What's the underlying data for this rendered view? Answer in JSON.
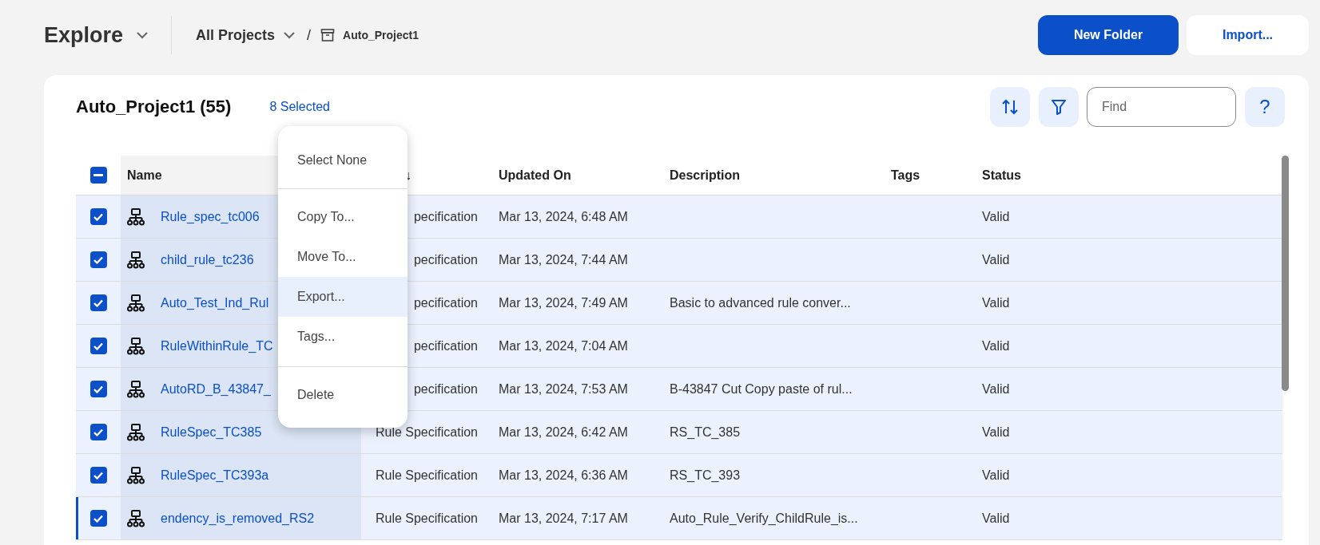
{
  "header": {
    "title": "Explore",
    "breadcrumb": {
      "root": "All Projects",
      "separator": "/",
      "current": "Auto_Project1"
    },
    "buttons": [
      {
        "label": "New Folder",
        "kind": "primary"
      },
      {
        "label": "Import...",
        "kind": "secondary"
      }
    ]
  },
  "panel": {
    "title": "Auto_Project1 (55)",
    "selection": "8 Selected",
    "find": {
      "placeholder": "Find"
    },
    "help": "?"
  },
  "menu": {
    "groups": [
      [
        {
          "label": "Select None",
          "selected": false
        }
      ],
      [
        {
          "label": "Copy To...",
          "selected": false
        },
        {
          "label": "Move To...",
          "selected": false
        },
        {
          "label": "Export...",
          "selected": true
        },
        {
          "label": "Tags...",
          "selected": false
        }
      ],
      [
        {
          "label": "Delete",
          "selected": false
        }
      ]
    ]
  },
  "table": {
    "select_all_partial": true,
    "columns": [
      {
        "label": "Name"
      },
      {
        "label": "↓"
      },
      {
        "label": "Updated On"
      },
      {
        "label": "Description"
      },
      {
        "label": "Tags"
      },
      {
        "label": "Status"
      }
    ],
    "rows": [
      {
        "checked": true,
        "focused": false,
        "name": "Rule_spec_tc006",
        "type": "pecification",
        "updated": "Mar 13, 2024, 6:48 AM",
        "status": "Valid"
      },
      {
        "checked": true,
        "focused": false,
        "name": "child_rule_tc236",
        "type": "pecification",
        "updated": "Mar 13, 2024, 7:44 AM",
        "status": "Valid"
      },
      {
        "checked": true,
        "focused": false,
        "name": "Auto_Test_Ind_Rul",
        "type": "pecification",
        "updated": "Mar 13, 2024, 7:49 AM",
        "description": "Basic to advanced rule conver...",
        "status": "Valid"
      },
      {
        "checked": true,
        "focused": false,
        "name": "RuleWithinRule_TC",
        "type": "pecification",
        "updated": "Mar 13, 2024, 7:04 AM",
        "status": "Valid"
      },
      {
        "checked": true,
        "focused": false,
        "name": "AutoRD_B_43847_",
        "type": "pecification",
        "updated": "Mar 13, 2024, 7:53 AM",
        "description": "B-43847 Cut Copy paste of rul...",
        "status": "Valid"
      },
      {
        "checked": true,
        "focused": false,
        "name": "RuleSpec_TC385",
        "type": "Rule Specification",
        "updated": "Mar 13, 2024, 6:42 AM",
        "description": "RS_TC_385",
        "status": "Valid"
      },
      {
        "checked": true,
        "focused": false,
        "name": "RuleSpec_TC393a",
        "type": "Rule Specification",
        "updated": "Mar 13, 2024, 6:36 AM",
        "description": "RS_TC_393",
        "status": "Valid"
      },
      {
        "checked": true,
        "focused": true,
        "name": "endency_is_removed_RS2",
        "type": "Rule Specification",
        "updated": "Mar 13, 2024, 7:17 AM",
        "description": "Auto_Rule_Verify_ChildRule_is...",
        "status": "Valid"
      }
    ]
  }
}
